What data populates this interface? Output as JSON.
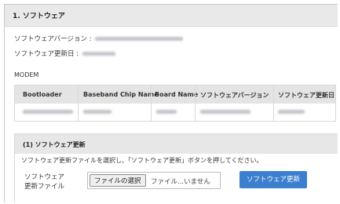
{
  "section": {
    "title": "1. ソフトウェア"
  },
  "software_info": {
    "version_label": "ソフトウェアバージョン :",
    "updated_label": "ソフトウェア更新日 :"
  },
  "modem": {
    "label": "MODEM",
    "columns": [
      "Bootloader",
      "Baseband Chip Name",
      "Board Name",
      "ソフトウェアバージョン",
      "ソフトウェア更新日"
    ]
  },
  "update_panel": {
    "title": "(1) ソフトウェア更新",
    "instruction": "ソフトウェア更新ファイルを選択し、「ソフトウェア更新」ボタンを押してください。",
    "file_label_line1": "ソフトウェア",
    "file_label_line2": "更新ファイル",
    "file_button": "ファイルの選択",
    "file_status": "ファイル...いません",
    "update_button": "ソフトウェア更新"
  }
}
